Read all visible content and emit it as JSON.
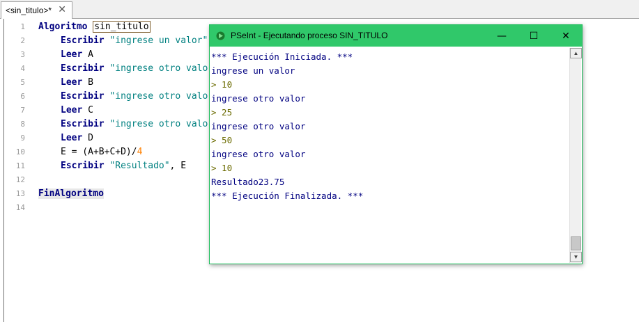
{
  "tab": {
    "label": "<sin_titulo>*",
    "close": "✕"
  },
  "editor": {
    "line_numbers": [
      "1",
      "2",
      "3",
      "4",
      "5",
      "6",
      "7",
      "8",
      "9",
      "10",
      "11",
      "12",
      "13",
      "14"
    ],
    "lines": [
      {
        "kw": "Algoritmo",
        "rest": "",
        "sel": "sin_titulo"
      },
      {
        "kw": "Escribir",
        "rest_str": "\"ingrese un valor\""
      },
      {
        "kw": "Leer",
        "rest": "A"
      },
      {
        "kw": "Escribir",
        "rest_str": "\"ingrese otro valor\""
      },
      {
        "kw": "Leer",
        "rest": "B"
      },
      {
        "kw": "Escribir",
        "rest_str": "\"ingrese otro valor\""
      },
      {
        "kw": "Leer",
        "rest": "C"
      },
      {
        "kw": "Escribir",
        "rest_str": "\"ingrese otro valor\""
      },
      {
        "kw": "Leer",
        "rest": "D"
      },
      {
        "expr": "E = (A+B+C+D)/",
        "num": "4"
      },
      {
        "kw": "Escribir",
        "rest_str": "\"Resultado\"",
        "rest_tail": ", E"
      },
      {},
      {
        "kw": "FinAlgoritmo"
      },
      {}
    ]
  },
  "console_window": {
    "title": "PSeInt - Ejecutando proceso SIN_TITULO",
    "minimize": "—",
    "maximize": "☐",
    "close": "✕",
    "lines": [
      {
        "text": "*** Ejecución Iniciada. ***",
        "kind": "sys"
      },
      {
        "text": "ingrese un valor",
        "kind": "out"
      },
      {
        "text": "> 10",
        "kind": "in"
      },
      {
        "text": "ingrese otro valor",
        "kind": "out"
      },
      {
        "text": "> 25",
        "kind": "in"
      },
      {
        "text": "ingrese otro valor",
        "kind": "out"
      },
      {
        "text": "> 50",
        "kind": "in"
      },
      {
        "text": "ingrese otro valor",
        "kind": "out"
      },
      {
        "text": "> 10",
        "kind": "in"
      },
      {
        "text": "Resultado23.75",
        "kind": "out"
      },
      {
        "text": "*** Ejecución Finalizada. ***",
        "kind": "sys"
      }
    ],
    "scroll_up": "▲",
    "scroll_down": "▼"
  },
  "colors": {
    "titlebar": "#30c86a",
    "keyword": "#000080",
    "string": "#008080",
    "number": "#ff8000"
  }
}
